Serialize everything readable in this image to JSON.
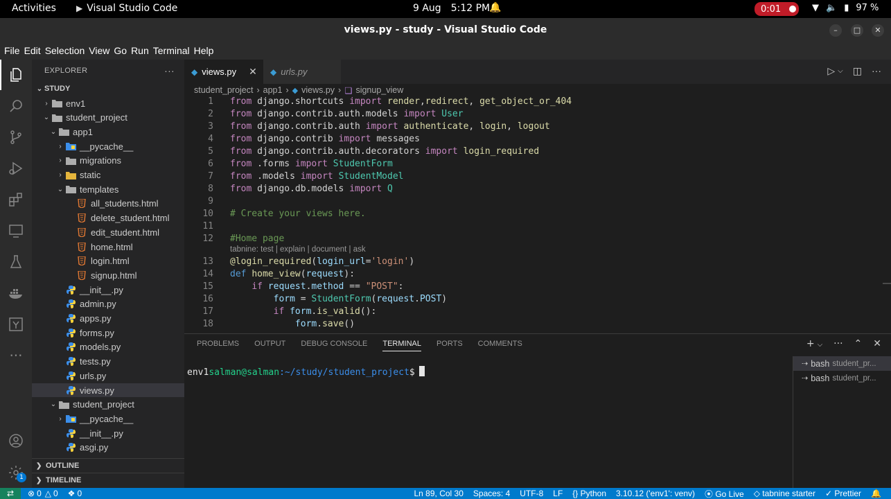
{
  "gnome": {
    "activities": "Activities",
    "app_name": "Visual Studio Code",
    "date": "9 Aug",
    "time": "5:12 PM",
    "recording": "0:01",
    "battery": "97 %"
  },
  "window": {
    "title": "views.py - study - Visual Studio Code"
  },
  "menu": [
    "File",
    "Edit",
    "Selection",
    "View",
    "Go",
    "Run",
    "Terminal",
    "Help"
  ],
  "explorer": {
    "header": "EXPLORER",
    "root": "STUDY",
    "items": [
      {
        "label": "env1"
      },
      {
        "label": "student_project"
      },
      {
        "label": "app1"
      },
      {
        "label": "__pycache__"
      },
      {
        "label": "migrations"
      },
      {
        "label": "static"
      },
      {
        "label": "templates"
      },
      {
        "label": "all_students.html"
      },
      {
        "label": "delete_student.html"
      },
      {
        "label": "edit_student.html"
      },
      {
        "label": "home.html"
      },
      {
        "label": "login.html"
      },
      {
        "label": "signup.html"
      },
      {
        "label": "__init__.py"
      },
      {
        "label": "admin.py"
      },
      {
        "label": "apps.py"
      },
      {
        "label": "forms.py"
      },
      {
        "label": "models.py"
      },
      {
        "label": "tests.py"
      },
      {
        "label": "urls.py"
      },
      {
        "label": "views.py"
      },
      {
        "label": "student_project"
      },
      {
        "label": "__pycache__"
      },
      {
        "label": "__init__.py"
      },
      {
        "label": "asgi.py"
      }
    ],
    "outline": "OUTLINE",
    "timeline": "TIMELINE"
  },
  "tabs": [
    {
      "label": "views.py",
      "active": true
    },
    {
      "label": "urls.py",
      "active": false
    }
  ],
  "breadcrumb": [
    "student_project",
    "app1",
    "views.py",
    "signup_view"
  ],
  "code": {
    "lens": "tabnine: test | explain | document | ask",
    "line_numbers": [
      "1",
      "2",
      "3",
      "4",
      "5",
      "6",
      "7",
      "8",
      "9",
      "10",
      "11",
      "12",
      "13",
      "14",
      "15",
      "16",
      "17",
      "18"
    ]
  },
  "panel": {
    "tabs": [
      "PROBLEMS",
      "OUTPUT",
      "DEBUG CONSOLE",
      "TERMINAL",
      "PORTS",
      "COMMENTS"
    ],
    "prompt_env": "env1",
    "prompt_user": "salman@salman",
    "prompt_path": ":~/study/student_project",
    "prompt_end": "$",
    "terminals": [
      {
        "name": "bash",
        "sub": "student_pr..."
      },
      {
        "name": "bash",
        "sub": "student_pr..."
      }
    ]
  },
  "status": {
    "errors": "0",
    "warnings": "0",
    "ports": "0",
    "position": "Ln 89, Col 30",
    "spaces": "Spaces: 4",
    "encoding": "UTF-8",
    "eol": "LF",
    "language": "Python",
    "interpreter": "3.10.12 ('env1': venv)",
    "golive": "Go Live",
    "tabnine": "tabnine starter",
    "prettier": "Prettier"
  },
  "colors": {
    "statusbar": "#007acc",
    "accent": "#0078d4",
    "recording": "#c01c28"
  }
}
